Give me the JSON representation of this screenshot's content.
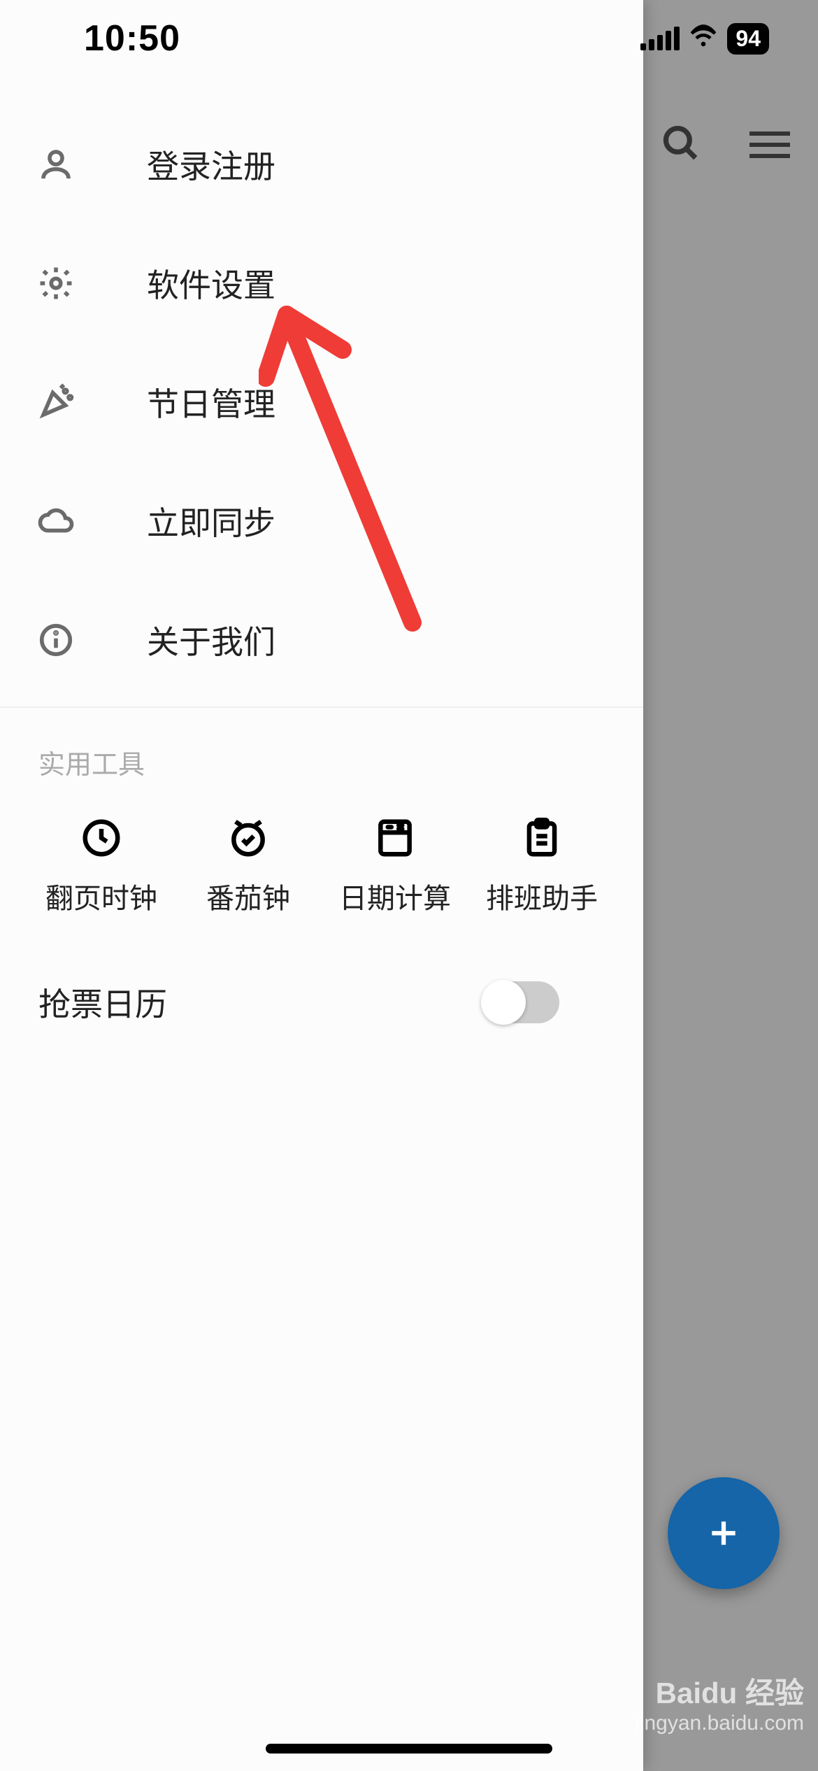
{
  "status": {
    "time": "10:50",
    "battery": "94"
  },
  "menu": {
    "items": [
      {
        "key": "login",
        "label": "登录注册"
      },
      {
        "key": "settings",
        "label": "软件设置"
      },
      {
        "key": "holidays",
        "label": "节日管理"
      },
      {
        "key": "sync",
        "label": "立即同步"
      },
      {
        "key": "about",
        "label": "关于我们"
      }
    ]
  },
  "tools": {
    "section_title": "实用工具",
    "items": [
      {
        "key": "flipclock",
        "label": "翻页时钟"
      },
      {
        "key": "pomodoro",
        "label": "番茄钟"
      },
      {
        "key": "datecalc",
        "label": "日期计算"
      },
      {
        "key": "shift",
        "label": "排班助手"
      }
    ]
  },
  "toggles": {
    "ticket_calendar": {
      "label": "抢票日历",
      "on": false
    }
  },
  "watermark": {
    "brand": "Baidu 经验",
    "url": "jingyan.baidu.com"
  },
  "annotation": {
    "type": "arrow",
    "target": "settings",
    "color": "#ef3c36"
  }
}
